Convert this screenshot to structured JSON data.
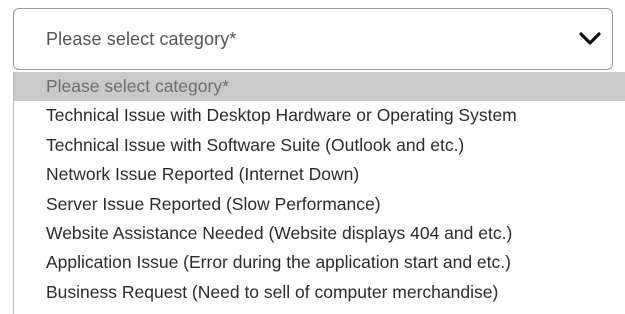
{
  "select": {
    "value": "Please select category*",
    "icon": "chevron-down-icon"
  },
  "options": [
    "Please select category*",
    "Technical Issue with Desktop Hardware or Operating System",
    "Technical Issue with Software Suite (Outlook and etc.)",
    "Network Issue Reported (Internet Down)",
    "Server Issue Reported (Slow Performance)",
    "Website Assistance Needed (Website displays 404 and etc.)",
    "Application Issue (Error during the application start and etc.)",
    "Business Request (Need to sell of computer merchandise)"
  ],
  "selected_index": 0,
  "colors": {
    "highlight": "#c9c9c9",
    "border": "#9b9b9b",
    "text": "#2b2b2b"
  }
}
